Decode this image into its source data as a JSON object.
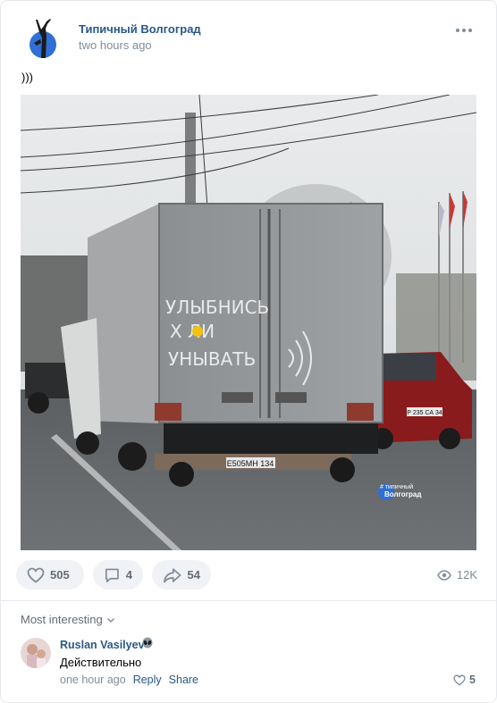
{
  "post": {
    "author": "Типичный Волгоград",
    "time": "two hours ago",
    "text": ")))",
    "photo": {
      "truck_graffiti_line1": "УЛЫБНИСЬ",
      "truck_graffiti_line2": "Х ЛИ",
      "truck_graffiti_line3": "УНЫВАТЬ",
      "truck_plate": "Е505МН 134",
      "car_plate": "Р 235 СА 34",
      "watermark_small": "# типичный",
      "watermark_big": "Волгоград"
    }
  },
  "actions": {
    "likes": "505",
    "comments": "4",
    "shares": "54",
    "views": "12K"
  },
  "comments_section": {
    "sort_label": "Most interesting",
    "comment": {
      "author": "Ruslan Vasilyev",
      "emoji_icon": "alien-icon",
      "text": "Действительно",
      "time": "one hour ago",
      "reply_label": "Reply",
      "share_label": "Share",
      "likes": "5"
    }
  },
  "colors": {
    "link": "#2a5885",
    "muted": "#818c99",
    "pill_bg": "#f0f2f5"
  }
}
